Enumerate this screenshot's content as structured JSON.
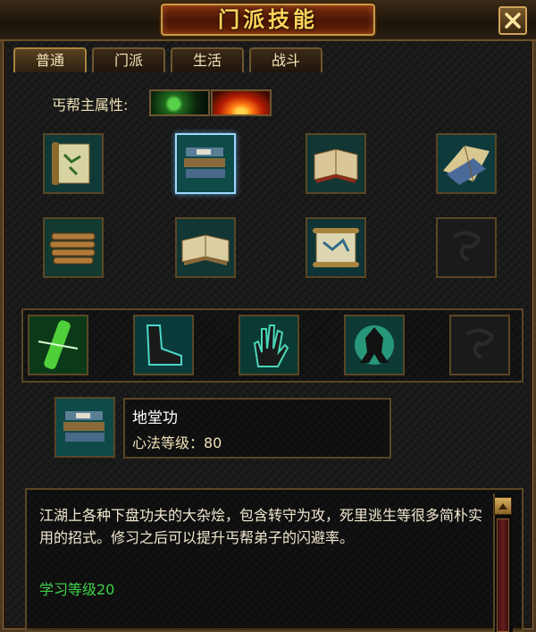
{
  "window": {
    "title": "门派技能"
  },
  "tabs": [
    {
      "label": "普通"
    },
    {
      "label": "门派"
    },
    {
      "label": "生活"
    },
    {
      "label": "战斗"
    }
  ],
  "attributes": {
    "label": "丐帮主属性:",
    "chips": [
      "poison-element",
      "fire-element"
    ]
  },
  "book_grid": [
    [
      "scroll-map",
      "book-stack",
      "open-book",
      "fan-of-books"
    ],
    [
      "bamboo-slips",
      "open-book",
      "scroll-map",
      "empty-slot"
    ]
  ],
  "skill_row": [
    "bamboo-staff",
    "foot",
    "palm",
    "shadow-figure",
    "empty-slot"
  ],
  "selected_skill": {
    "name": "地堂功",
    "level_text": "心法等级：80"
  },
  "description": {
    "text": "江湖上各种下盘功夫的大杂烩，包含转守为攻，死里逃生等很多简朴实用的招式。修习之后可以提升丐帮弟子的闪避率。",
    "requirement": "学习等级20"
  },
  "colors": {
    "title": "#ffd25a",
    "requirement": "#3fd24a",
    "selection": "#9ed9ff"
  }
}
